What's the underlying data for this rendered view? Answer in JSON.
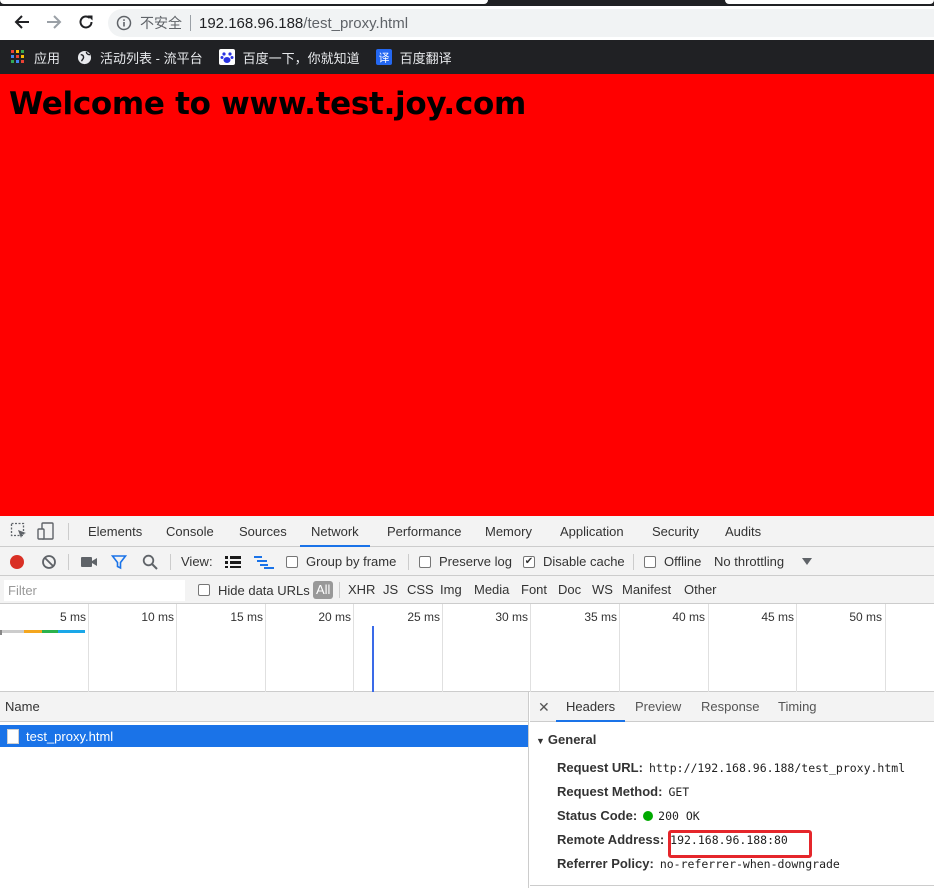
{
  "browser": {
    "omnibox": {
      "security_label": "不安全",
      "url_host": "192.168.96.188",
      "url_path": "/test_proxy.html"
    },
    "bookmarks": [
      {
        "label": "应用",
        "icon": "apps-grid-icon"
      },
      {
        "label": "活动列表 - 流平台",
        "icon": "globe-icon"
      },
      {
        "label": "百度一下，你就知道",
        "icon": "baidu-paw-icon"
      },
      {
        "label": "百度翻译",
        "icon": "translate-icon"
      }
    ]
  },
  "page": {
    "heading": "Welcome to www.test.joy.com",
    "background_color": "#ff0000"
  },
  "devtools": {
    "tabs": [
      "Elements",
      "Console",
      "Sources",
      "Network",
      "Performance",
      "Memory",
      "Application",
      "Security",
      "Audits"
    ],
    "active_tab": "Network",
    "toolbar": {
      "view_label": "View:",
      "group_by_frame": "Group by frame",
      "preserve_log": "Preserve log",
      "disable_cache": "Disable cache",
      "offline": "Offline",
      "throttling": "No throttling"
    },
    "filterbar": {
      "filter_placeholder": "Filter",
      "hide_data_urls": "Hide data URLs",
      "types": [
        "All",
        "XHR",
        "JS",
        "CSS",
        "Img",
        "Media",
        "Font",
        "Doc",
        "WS",
        "Manifest",
        "Other"
      ]
    },
    "overview_ticks": [
      "5 ms",
      "10 ms",
      "15 ms",
      "20 ms",
      "25 ms",
      "30 ms",
      "35 ms",
      "40 ms",
      "45 ms",
      "50 ms"
    ],
    "request_list": {
      "header": "Name",
      "rows": [
        "test_proxy.html"
      ]
    },
    "details": {
      "tabs": [
        "Headers",
        "Preview",
        "Response",
        "Timing"
      ],
      "active_tab": "Headers",
      "general_title": "General",
      "general": [
        {
          "key": "Request URL:",
          "value": "http://192.168.96.188/test_proxy.html"
        },
        {
          "key": "Request Method:",
          "value": "GET"
        },
        {
          "key": "Status Code:",
          "value": "200 OK"
        },
        {
          "key": "Remote Address:",
          "value": "192.168.96.188:80"
        },
        {
          "key": "Referrer Policy:",
          "value": "no-referrer-when-downgrade"
        }
      ]
    }
  }
}
